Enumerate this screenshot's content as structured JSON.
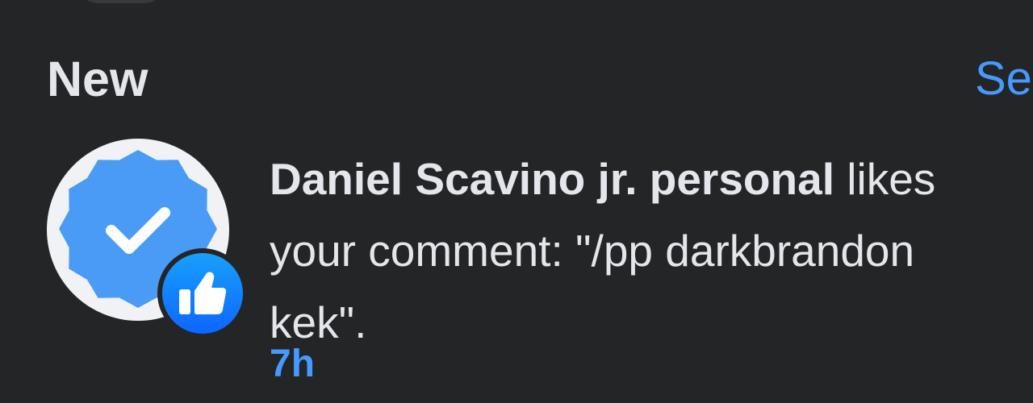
{
  "section": {
    "title": "New",
    "see_all_label": "Se"
  },
  "notification": {
    "actor": "Daniel Scavino jr. personal",
    "action": " likes your comment: \"/pp darkbrandon kek\".",
    "time": "7h",
    "reaction_icon": "like-thumbs-up-icon",
    "avatar_icon": "verified-badge-icon"
  },
  "colors": {
    "background": "#242526",
    "text": "#e4e6eb",
    "accent": "#4599ff",
    "badge_blue": "#4a9bf5",
    "reaction_blue": "#0d66ff"
  }
}
